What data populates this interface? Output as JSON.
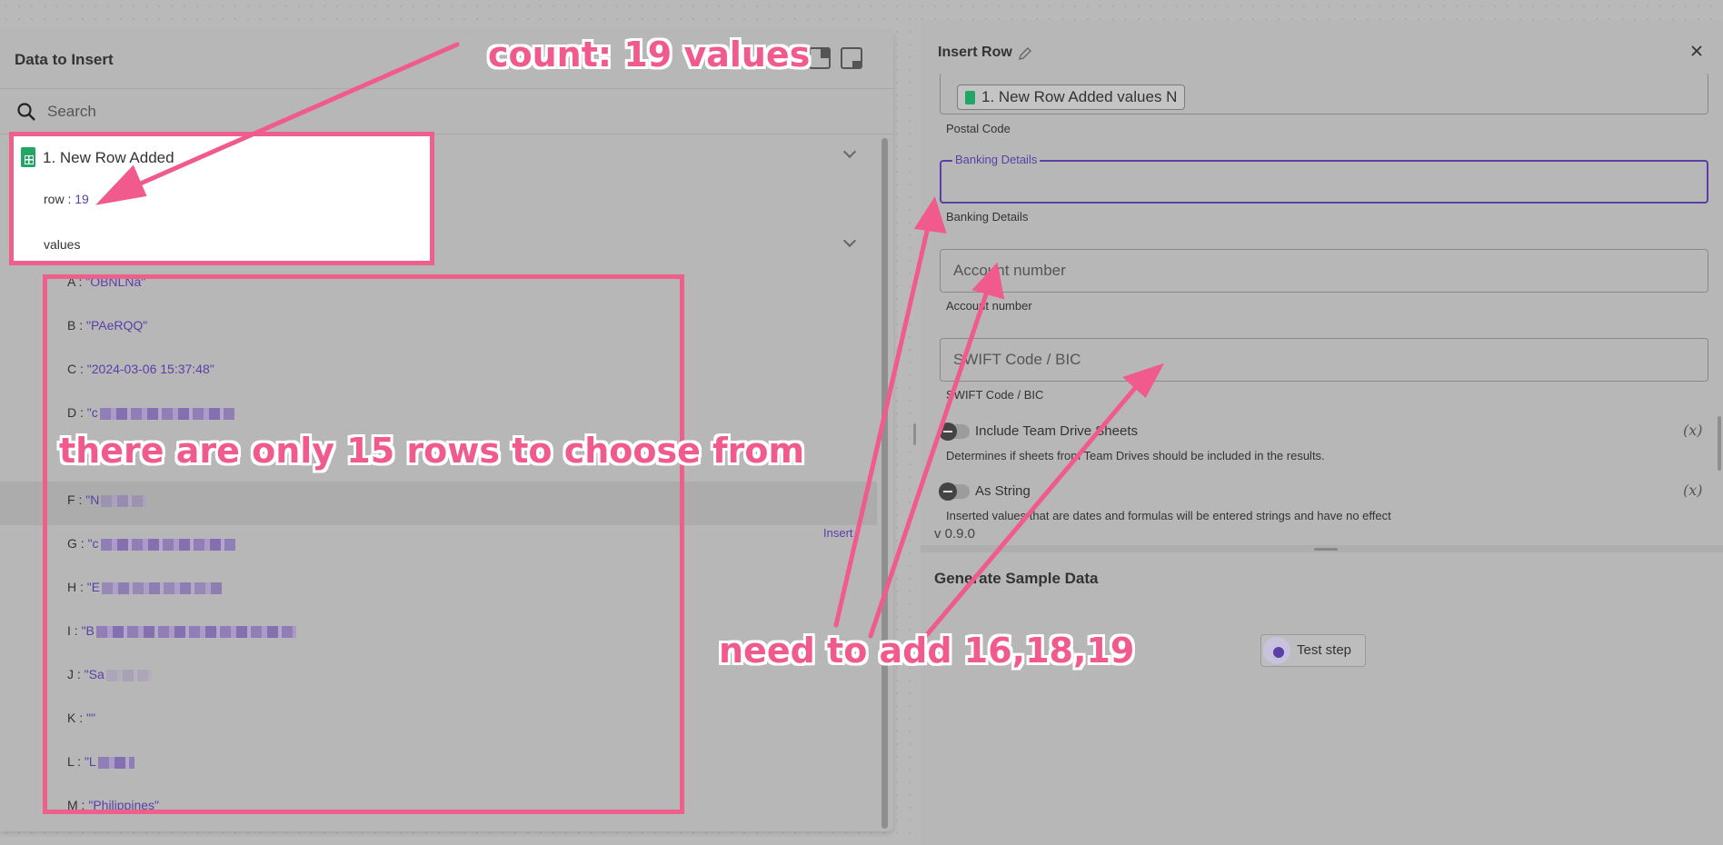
{
  "left_panel": {
    "title": "Data to Insert",
    "search_placeholder": "Search",
    "step_title": "1. New Row Added",
    "row_label": "row : ",
    "row_value": "19",
    "values_label": "values",
    "insert_label": "Insert",
    "values": [
      {
        "key": "A : ",
        "value": "\"OBNLNa\""
      },
      {
        "key": "B : ",
        "value": "\"PAeRQQ\""
      },
      {
        "key": "C : ",
        "value": "\"2024-03-06 15:37:48\""
      },
      {
        "key": "D : ",
        "value": "\"c"
      },
      {
        "key": "F : ",
        "value": "\"N"
      },
      {
        "key": "G : ",
        "value": "\"c"
      },
      {
        "key": "H : ",
        "value": "\"E"
      },
      {
        "key": "I : ",
        "value": "\"B"
      },
      {
        "key": "J : ",
        "value": "\"Sa"
      },
      {
        "key": "K : ",
        "value": "\"\""
      },
      {
        "key": "L : ",
        "value": "\"L"
      },
      {
        "key": "M : ",
        "value": "\"Philippines\""
      }
    ]
  },
  "right_panel": {
    "title": "Insert Row",
    "postal_chip": "1. New Row Added values N",
    "postal_caption": "Postal Code",
    "banking_label": "Banking Details",
    "banking_caption": "Banking Details",
    "account_placeholder": "Account number",
    "account_caption": "Account number",
    "swift_placeholder": "SWIFT Code / BIC",
    "swift_caption": "SWIFT Code / BIC",
    "team_drive_label": "Include Team Drive Sheets",
    "team_drive_desc": "Determines if sheets from Team Drives should be included in the results.",
    "as_string_label": "As String",
    "as_string_desc": "Inserted values that are dates and formulas will be entered strings and have no effect",
    "fx_label": "(x)",
    "version": "v 0.9.0",
    "sample_title": "Generate Sample Data",
    "test_button": "Test step"
  },
  "annotations": {
    "count_note": "count: 19 values",
    "rows_note": "there are only 15 rows to choose from",
    "add_note": "need to add 16,18,19"
  },
  "colors": {
    "annotation": "#f05a8c",
    "accent": "#5a3fa6",
    "sheets_green": "#23a566"
  }
}
